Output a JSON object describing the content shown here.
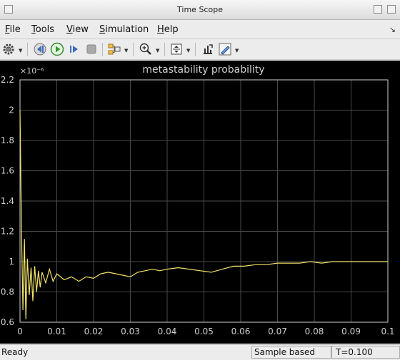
{
  "window": {
    "title": "Time Scope"
  },
  "menu": [
    {
      "mnemonic": "F",
      "rest": "ile"
    },
    {
      "mnemonic": "T",
      "rest": "ools"
    },
    {
      "mnemonic": "V",
      "rest": "iew"
    },
    {
      "mnemonic": "S",
      "rest": "imulation"
    },
    {
      "mnemonic": "H",
      "rest": "elp"
    }
  ],
  "toolbar": {
    "icons": [
      "settings-icon",
      "step-back-icon",
      "run-icon",
      "step-forward-icon",
      "stop-icon",
      "signal-selector-icon",
      "zoom-in-icon",
      "scale-axes-icon",
      "restore-icon",
      "highlight-icon"
    ]
  },
  "status": {
    "left": "Ready",
    "mode": "Sample based",
    "time": "T=0.100"
  },
  "chart_data": {
    "type": "line",
    "title": "metastability probability",
    "y_exponent_label": "×10⁻⁶",
    "xlim": [
      0,
      0.1
    ],
    "ylim": [
      0.6,
      2.2
    ],
    "xticks": [
      "0",
      "0.01",
      "0.02",
      "0.03",
      "0.04",
      "0.05",
      "0.06",
      "0.07",
      "0.08",
      "0.09",
      "0.1"
    ],
    "yticks": [
      "0.6",
      "0.8",
      "1",
      "1.2",
      "1.4",
      "1.6",
      "1.8",
      "2",
      "2.2"
    ],
    "grid": true,
    "background": "#000000",
    "grid_color": "#4a4a4a",
    "axis_color": "#cfcfcf",
    "series": [
      {
        "color": "#f3e36a",
        "x": [
          0,
          0.0004,
          0.0008,
          0.0012,
          0.0016,
          0.002,
          0.0025,
          0.003,
          0.0035,
          0.004,
          0.0045,
          0.005,
          0.0055,
          0.006,
          0.007,
          0.008,
          0.009,
          0.01,
          0.012,
          0.014,
          0.016,
          0.018,
          0.02,
          0.022,
          0.024,
          0.026,
          0.028,
          0.03,
          0.032,
          0.034,
          0.036,
          0.038,
          0.04,
          0.043,
          0.046,
          0.049,
          0.052,
          0.055,
          0.058,
          0.061,
          0.064,
          0.067,
          0.07,
          0.073,
          0.076,
          0.079,
          0.082,
          0.085,
          0.088,
          0.091,
          0.094,
          0.097,
          0.1
        ],
        "y": [
          2.0,
          1.2,
          0.68,
          1.15,
          0.62,
          1.02,
          0.78,
          0.96,
          0.74,
          0.97,
          0.8,
          0.94,
          0.83,
          0.93,
          0.86,
          0.95,
          0.87,
          0.92,
          0.88,
          0.9,
          0.87,
          0.9,
          0.89,
          0.92,
          0.93,
          0.92,
          0.91,
          0.9,
          0.93,
          0.94,
          0.95,
          0.94,
          0.95,
          0.96,
          0.95,
          0.94,
          0.93,
          0.95,
          0.97,
          0.97,
          0.98,
          0.98,
          0.99,
          0.99,
          0.99,
          1.0,
          0.99,
          1.0,
          1.0,
          1.0,
          1.0,
          1.0,
          1.0
        ]
      }
    ]
  }
}
